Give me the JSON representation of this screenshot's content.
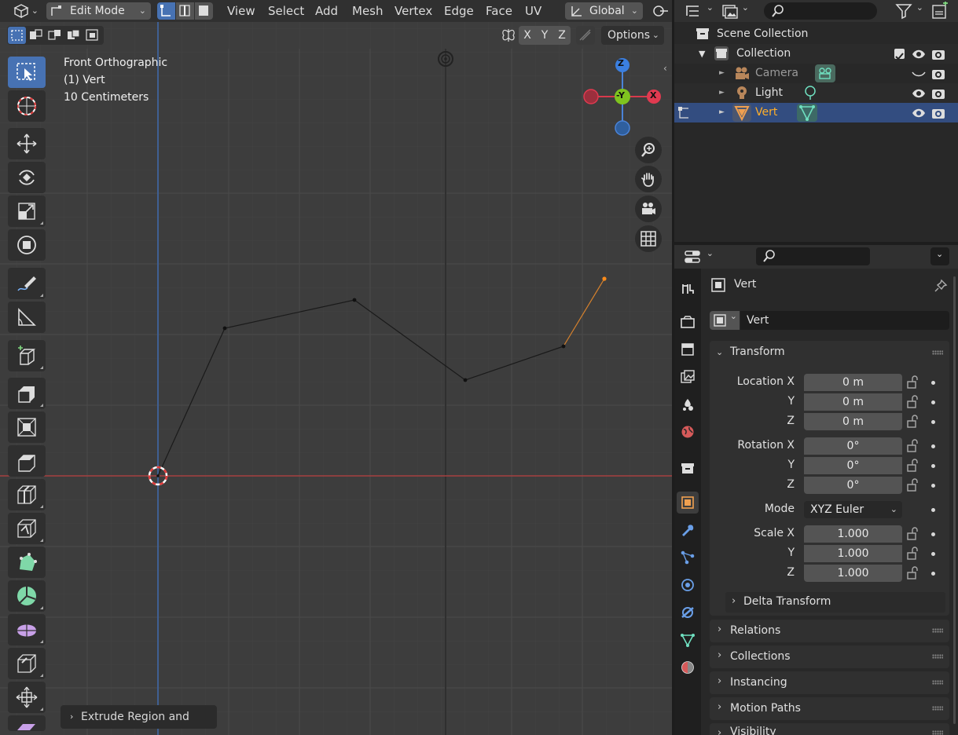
{
  "viewport": {
    "header": {
      "mode": "Edit Mode",
      "menus": [
        "View",
        "Select",
        "Add",
        "Mesh",
        "Vertex",
        "Edge",
        "Face",
        "UV"
      ],
      "orientation": "Global"
    },
    "subheader": {
      "axes": [
        "X",
        "Y",
        "Z"
      ],
      "options_label": "Options"
    },
    "info": {
      "view_name": "Front Orthographic",
      "object_line": "(1) Vert",
      "scale_line": "10 Centimeters"
    },
    "gizmo": {
      "z": "Z",
      "y": "-Y",
      "x": "X"
    },
    "operator_panel": "Extrude Region and Move"
  },
  "outliner": {
    "scene_collection": "Scene Collection",
    "rows": [
      {
        "name": "Collection"
      },
      {
        "name": "Camera"
      },
      {
        "name": "Light"
      },
      {
        "name": "Vert"
      }
    ]
  },
  "properties": {
    "object_name": "Vert",
    "datablock_name": "Vert",
    "transform": {
      "title": "Transform",
      "location_label": "Location X",
      "rotation_label": "Rotation X",
      "scale_label": "Scale X",
      "y_label": "Y",
      "z_label": "Z",
      "mode_label": "Mode",
      "location": [
        "0 m",
        "0 m",
        "0 m"
      ],
      "rotation": [
        "0°",
        "0°",
        "0°"
      ],
      "mode": "XYZ Euler",
      "scale": [
        "1.000",
        "1.000",
        "1.000"
      ],
      "delta": "Delta Transform"
    },
    "panels": [
      "Relations",
      "Collections",
      "Instancing",
      "Motion Paths",
      "Visibility"
    ]
  }
}
